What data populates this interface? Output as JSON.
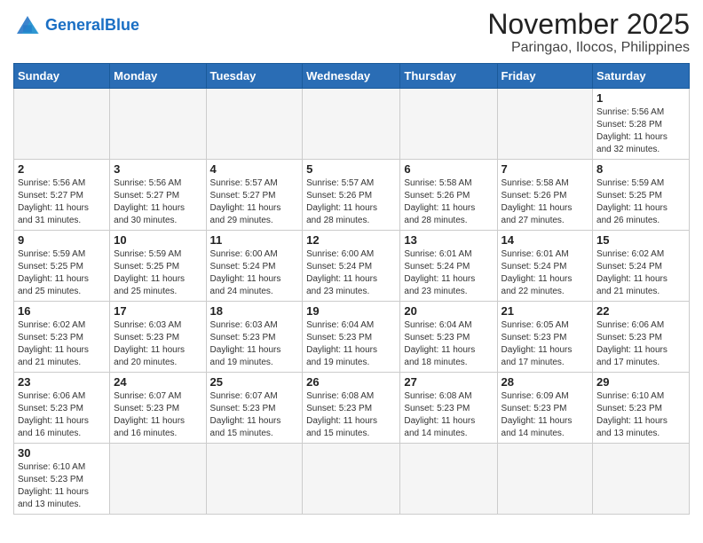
{
  "header": {
    "logo_general": "General",
    "logo_blue": "Blue",
    "month": "November 2025",
    "location": "Paringao, Ilocos, Philippines"
  },
  "weekdays": [
    "Sunday",
    "Monday",
    "Tuesday",
    "Wednesday",
    "Thursday",
    "Friday",
    "Saturday"
  ],
  "weeks": [
    [
      {
        "day": "",
        "info": ""
      },
      {
        "day": "",
        "info": ""
      },
      {
        "day": "",
        "info": ""
      },
      {
        "day": "",
        "info": ""
      },
      {
        "day": "",
        "info": ""
      },
      {
        "day": "",
        "info": ""
      },
      {
        "day": "1",
        "info": "Sunrise: 5:56 AM\nSunset: 5:28 PM\nDaylight: 11 hours\nand 32 minutes."
      }
    ],
    [
      {
        "day": "2",
        "info": "Sunrise: 5:56 AM\nSunset: 5:27 PM\nDaylight: 11 hours\nand 31 minutes."
      },
      {
        "day": "3",
        "info": "Sunrise: 5:56 AM\nSunset: 5:27 PM\nDaylight: 11 hours\nand 30 minutes."
      },
      {
        "day": "4",
        "info": "Sunrise: 5:57 AM\nSunset: 5:27 PM\nDaylight: 11 hours\nand 29 minutes."
      },
      {
        "day": "5",
        "info": "Sunrise: 5:57 AM\nSunset: 5:26 PM\nDaylight: 11 hours\nand 28 minutes."
      },
      {
        "day": "6",
        "info": "Sunrise: 5:58 AM\nSunset: 5:26 PM\nDaylight: 11 hours\nand 28 minutes."
      },
      {
        "day": "7",
        "info": "Sunrise: 5:58 AM\nSunset: 5:26 PM\nDaylight: 11 hours\nand 27 minutes."
      },
      {
        "day": "8",
        "info": "Sunrise: 5:59 AM\nSunset: 5:25 PM\nDaylight: 11 hours\nand 26 minutes."
      }
    ],
    [
      {
        "day": "9",
        "info": "Sunrise: 5:59 AM\nSunset: 5:25 PM\nDaylight: 11 hours\nand 25 minutes."
      },
      {
        "day": "10",
        "info": "Sunrise: 5:59 AM\nSunset: 5:25 PM\nDaylight: 11 hours\nand 25 minutes."
      },
      {
        "day": "11",
        "info": "Sunrise: 6:00 AM\nSunset: 5:24 PM\nDaylight: 11 hours\nand 24 minutes."
      },
      {
        "day": "12",
        "info": "Sunrise: 6:00 AM\nSunset: 5:24 PM\nDaylight: 11 hours\nand 23 minutes."
      },
      {
        "day": "13",
        "info": "Sunrise: 6:01 AM\nSunset: 5:24 PM\nDaylight: 11 hours\nand 23 minutes."
      },
      {
        "day": "14",
        "info": "Sunrise: 6:01 AM\nSunset: 5:24 PM\nDaylight: 11 hours\nand 22 minutes."
      },
      {
        "day": "15",
        "info": "Sunrise: 6:02 AM\nSunset: 5:24 PM\nDaylight: 11 hours\nand 21 minutes."
      }
    ],
    [
      {
        "day": "16",
        "info": "Sunrise: 6:02 AM\nSunset: 5:23 PM\nDaylight: 11 hours\nand 21 minutes."
      },
      {
        "day": "17",
        "info": "Sunrise: 6:03 AM\nSunset: 5:23 PM\nDaylight: 11 hours\nand 20 minutes."
      },
      {
        "day": "18",
        "info": "Sunrise: 6:03 AM\nSunset: 5:23 PM\nDaylight: 11 hours\nand 19 minutes."
      },
      {
        "day": "19",
        "info": "Sunrise: 6:04 AM\nSunset: 5:23 PM\nDaylight: 11 hours\nand 19 minutes."
      },
      {
        "day": "20",
        "info": "Sunrise: 6:04 AM\nSunset: 5:23 PM\nDaylight: 11 hours\nand 18 minutes."
      },
      {
        "day": "21",
        "info": "Sunrise: 6:05 AM\nSunset: 5:23 PM\nDaylight: 11 hours\nand 17 minutes."
      },
      {
        "day": "22",
        "info": "Sunrise: 6:06 AM\nSunset: 5:23 PM\nDaylight: 11 hours\nand 17 minutes."
      }
    ],
    [
      {
        "day": "23",
        "info": "Sunrise: 6:06 AM\nSunset: 5:23 PM\nDaylight: 11 hours\nand 16 minutes."
      },
      {
        "day": "24",
        "info": "Sunrise: 6:07 AM\nSunset: 5:23 PM\nDaylight: 11 hours\nand 16 minutes."
      },
      {
        "day": "25",
        "info": "Sunrise: 6:07 AM\nSunset: 5:23 PM\nDaylight: 11 hours\nand 15 minutes."
      },
      {
        "day": "26",
        "info": "Sunrise: 6:08 AM\nSunset: 5:23 PM\nDaylight: 11 hours\nand 15 minutes."
      },
      {
        "day": "27",
        "info": "Sunrise: 6:08 AM\nSunset: 5:23 PM\nDaylight: 11 hours\nand 14 minutes."
      },
      {
        "day": "28",
        "info": "Sunrise: 6:09 AM\nSunset: 5:23 PM\nDaylight: 11 hours\nand 14 minutes."
      },
      {
        "day": "29",
        "info": "Sunrise: 6:10 AM\nSunset: 5:23 PM\nDaylight: 11 hours\nand 13 minutes."
      }
    ],
    [
      {
        "day": "30",
        "info": "Sunrise: 6:10 AM\nSunset: 5:23 PM\nDaylight: 11 hours\nand 13 minutes."
      },
      {
        "day": "",
        "info": ""
      },
      {
        "day": "",
        "info": ""
      },
      {
        "day": "",
        "info": ""
      },
      {
        "day": "",
        "info": ""
      },
      {
        "day": "",
        "info": ""
      },
      {
        "day": "",
        "info": ""
      }
    ]
  ]
}
